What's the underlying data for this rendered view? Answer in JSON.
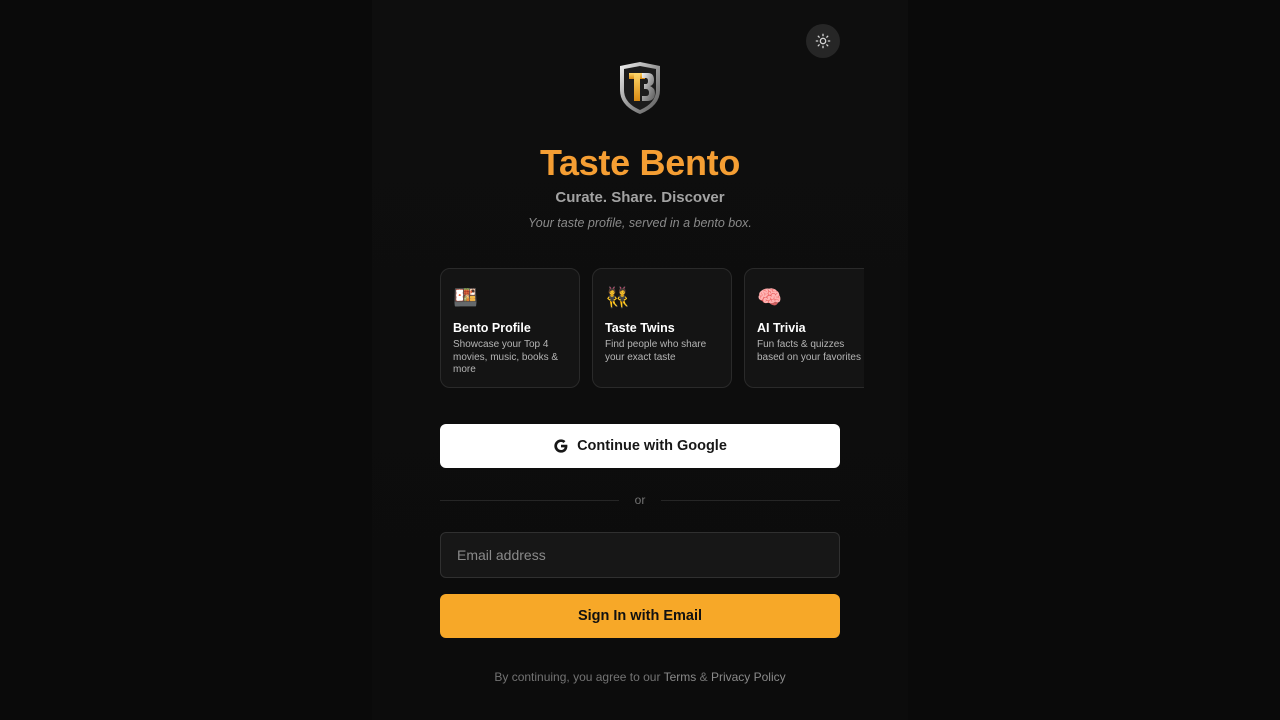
{
  "app": {
    "title": "Taste Bento",
    "tagline": "Curate. Share. Discover",
    "subtagline": "Your taste profile, served in a bento box."
  },
  "theme_toggle": {
    "icon": "sun-icon"
  },
  "logo": {
    "icon": "tb-shield-logo",
    "text": "TB"
  },
  "features": [
    {
      "icon": "bento-box-emoji",
      "emoji": "🍱",
      "title": "Bento Profile",
      "description": "Showcase your Top 4 movies, music, books & more"
    },
    {
      "icon": "twins-emoji",
      "emoji": "👯",
      "title": "Taste Twins",
      "description": "Find people who share your exact taste"
    },
    {
      "icon": "brain-emoji",
      "emoji": "🧠",
      "title": "AI Trivia",
      "description": "Fun facts & quizzes based on your favorites"
    }
  ],
  "auth": {
    "google_label": "Continue with Google",
    "divider_label": "or",
    "email_placeholder": "Email address",
    "email_value": "",
    "email_button_label": "Sign In with Email"
  },
  "legal": {
    "prefix": "By continuing, you agree to our ",
    "terms": "Terms",
    "amp": " & ",
    "privacy": "Privacy Policy"
  },
  "colors": {
    "accent": "#f59e33",
    "button_primary": "#f7a828",
    "background": "#0a0a0a"
  }
}
